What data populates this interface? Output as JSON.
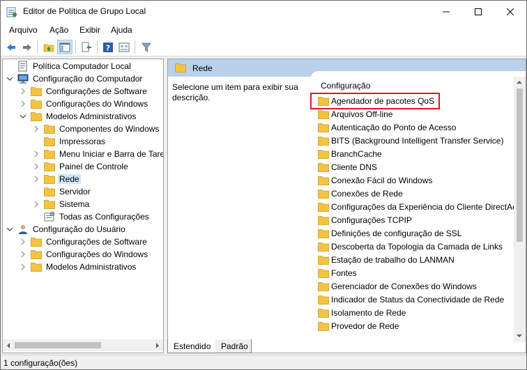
{
  "window": {
    "title": "Editor de Política de Grupo Local"
  },
  "menu": [
    "Arquivo",
    "Ação",
    "Exibir",
    "Ajuda"
  ],
  "toolbar": [
    "back-arrow-icon",
    "forward-arrow-icon",
    "up-folder-icon",
    "show-hide-tree-icon",
    "export-list-icon",
    "help-icon",
    "properties-view-icon",
    "filter-icon"
  ],
  "tree": [
    {
      "label": "Política Computador Local",
      "depth": 0,
      "expander": "none",
      "icon": "policy"
    },
    {
      "label": "Configuração do Computador",
      "depth": 0,
      "expander": "open",
      "icon": "computer"
    },
    {
      "label": "Configurações de Software",
      "depth": 1,
      "expander": "closed",
      "icon": "folder"
    },
    {
      "label": "Configurações do Windows",
      "depth": 1,
      "expander": "closed",
      "icon": "folder"
    },
    {
      "label": "Modelos Administrativos",
      "depth": 1,
      "expander": "open",
      "icon": "folder"
    },
    {
      "label": "Componentes do Windows",
      "depth": 2,
      "expander": "closed",
      "icon": "folder"
    },
    {
      "label": "Impressoras",
      "depth": 2,
      "expander": "none",
      "icon": "folder"
    },
    {
      "label": "Menu Iniciar e Barra de Taref",
      "depth": 2,
      "expander": "closed",
      "icon": "folder"
    },
    {
      "label": "Painel de Controle",
      "depth": 2,
      "expander": "closed",
      "icon": "folder"
    },
    {
      "label": "Rede",
      "depth": 2,
      "expander": "closed",
      "icon": "folder",
      "selected": true
    },
    {
      "label": "Servidor",
      "depth": 2,
      "expander": "none",
      "icon": "folder"
    },
    {
      "label": "Sistema",
      "depth": 2,
      "expander": "closed",
      "icon": "folder"
    },
    {
      "label": "Todas as Configurações",
      "depth": 2,
      "expander": "none",
      "icon": "settings"
    },
    {
      "label": "Configuração do Usuário",
      "depth": 0,
      "expander": "open",
      "icon": "user"
    },
    {
      "label": "Configurações de Software",
      "depth": 1,
      "expander": "closed",
      "icon": "folder"
    },
    {
      "label": "Configurações do Windows",
      "depth": 1,
      "expander": "closed",
      "icon": "folder"
    },
    {
      "label": "Modelos Administrativos",
      "depth": 1,
      "expander": "closed",
      "icon": "folder"
    }
  ],
  "details": {
    "title": "Rede",
    "description": "Selecione um item para exibir sua descrição.",
    "column_header": "Configuração",
    "items": [
      "Agendador de pacotes QoS",
      "Arquivos Off-line",
      "Autenticação do Ponto de Acesso",
      "BITS (Background Intelligent Transfer Service)",
      "BranchCache",
      "Cliente DNS",
      "Conexão Fácil do Windows",
      "Conexões de Rede",
      "Configurações da Experiência do Cliente DirectAc",
      "Configurações TCPIP",
      "Definições de configuração de SSL",
      "Descoberta da Topologia da Camada de Links",
      "Estação de trabalho do LANMAN",
      "Fontes",
      "Gerenciador de Conexões do Windows",
      "Indicador de Status da Conectividade de Rede",
      "Isolamento de Rede",
      "Provedor de Rede"
    ],
    "highlighted_index": 0
  },
  "tabs": [
    "Estendido",
    "Padrão"
  ],
  "status": "1 configuração(ões)",
  "colors": {
    "selection": "#cce8ff",
    "header": "#b9d1ea",
    "highlight": "#e81123",
    "folder": "#f5c342"
  }
}
